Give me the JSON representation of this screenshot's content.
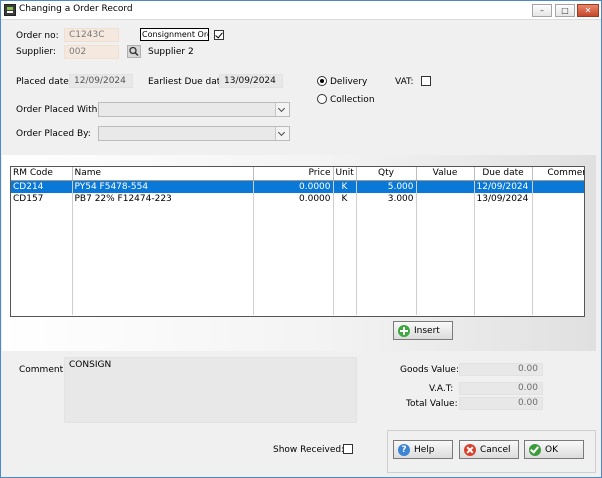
{
  "window": {
    "title": "Changing a Order Record"
  },
  "header": {
    "order_no_label": "Order no:",
    "order_no": "C1243C",
    "consignment_label": "Consignment Order",
    "consignment_checked": true,
    "supplier_label": "Supplier:",
    "supplier_code": "002",
    "supplier_name": "Supplier 2",
    "placed_date_label": "Placed date:",
    "placed_date": "12/09/2024",
    "earliest_due_label": "Earliest Due date:",
    "earliest_due": "13/09/2024",
    "delivery_label": "Delivery",
    "collection_label": "Collection",
    "vat_label": "VAT:",
    "placed_with_label": "Order Placed With:",
    "placed_by_label": "Order Placed By:"
  },
  "grid": {
    "columns": [
      "RM Code",
      "Name",
      "Price",
      "Unit",
      "Qty",
      "Value",
      "Due date",
      "Comment"
    ],
    "rows": [
      {
        "code": "CD214",
        "name": "PY54 F5478-554",
        "price": "0.0000",
        "unit": "K",
        "qty": "5.000",
        "value": "",
        "due": "12/09/2024",
        "comment": ""
      },
      {
        "code": "CD157",
        "name": "PB7 22% F12474-223",
        "price": "0.0000",
        "unit": "K",
        "qty": "3.000",
        "value": "",
        "due": "13/09/2024",
        "comment": ""
      }
    ]
  },
  "insert_button": "Insert",
  "comment_label": "Comment:",
  "comment_value": "CONSIGN",
  "totals": {
    "goods_label": "Goods Value:",
    "goods_value": "0.00",
    "vat_label": "V.A.T:",
    "vat_value": "0.00",
    "total_label": "Total Value:",
    "total_value": "0.00"
  },
  "show_received_label": "Show Received:",
  "buttons": {
    "help": "Help",
    "cancel": "Cancel",
    "ok": "OK"
  },
  "colors": {
    "selection": "#0a78d7",
    "editable_field": "#f5e9df",
    "window_border": "#4d88c9"
  }
}
